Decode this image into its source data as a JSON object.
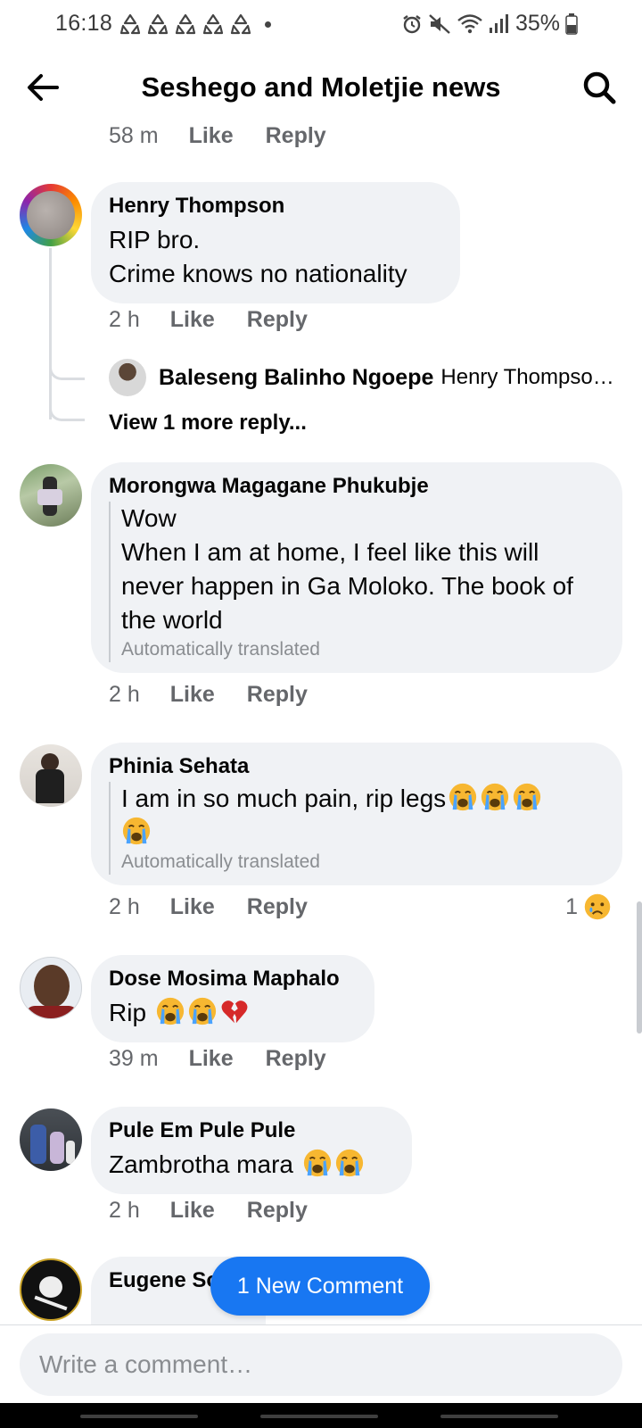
{
  "status_bar": {
    "time": "16:18",
    "battery": "35%",
    "notification_icons": [
      "recycle-icon",
      "recycle-icon",
      "recycle-icon",
      "recycle-icon",
      "recycle-icon"
    ],
    "right_icons": [
      "alarm-icon",
      "mute-icon",
      "wifi-icon",
      "signal-icon",
      "battery-icon"
    ]
  },
  "header": {
    "title": "Seshego and Moletjie news",
    "back_icon": "arrow-left-icon",
    "search_icon": "search-icon"
  },
  "actions": {
    "like": "Like",
    "reply": "Reply"
  },
  "top_meta": {
    "time": "58 m"
  },
  "comments": [
    {
      "name": "Henry Thompson",
      "text": "RIP bro.\nCrime knows no nationality",
      "time": "2 h",
      "replies_preview": {
        "name": "Baleseng Balinho Ngoepe",
        "text": "Henry Thompso…",
        "view_more": "View 1 more reply..."
      }
    },
    {
      "name": "Morongwa Magagane Phukubje",
      "text": "Wow\nWhen I am at home, I feel like this will never happen in Ga Moloko. The book of the world",
      "translated_note": "Automatically translated",
      "time": "2 h"
    },
    {
      "name": "Phinia Sehata",
      "text": "I am in so much pain, rip legs",
      "emojis": [
        "crying-face",
        "crying-face",
        "crying-face",
        "crying-face"
      ],
      "translated_note": "Automatically translated",
      "time": "2 h",
      "reaction": {
        "count": "1",
        "icon": "sad-face-icon"
      }
    },
    {
      "name": "Dose Mosima Maphalo",
      "text": "Rip",
      "emojis": [
        "crying-face",
        "crying-face",
        "broken-heart"
      ],
      "time": "39 m"
    },
    {
      "name": "Pule Em Pule Pule",
      "text": "Zambrotha mara",
      "emojis": [
        "crying-face",
        "crying-face"
      ],
      "time": "2 h"
    },
    {
      "name": "Eugene So"
    }
  ],
  "new_comment_button": "1 New Comment",
  "composer": {
    "placeholder": "Write a comment…"
  },
  "colors": {
    "accent": "#1877f2",
    "bubble": "#f0f2f5",
    "meta_text": "#65676b",
    "muted_text": "#8a8d91"
  }
}
